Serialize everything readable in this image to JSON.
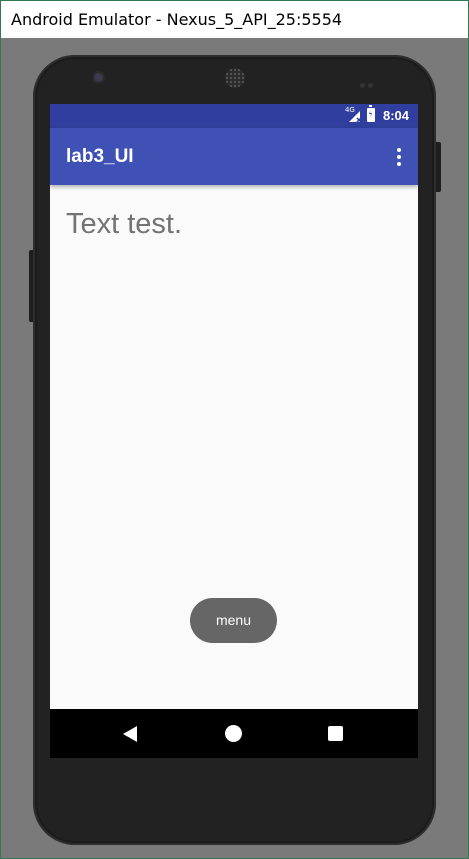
{
  "window": {
    "title": "Android Emulator - Nexus_5_API_25:5554"
  },
  "status_bar": {
    "network_label": "4G",
    "time": "8:04"
  },
  "toolbar": {
    "title": "lab3_UI"
  },
  "content": {
    "text": "Text test."
  },
  "menu_button": {
    "label": "menu"
  },
  "colors": {
    "status_bar": "#303f9f",
    "toolbar": "#3f51b5",
    "menu_button": "#666666"
  }
}
